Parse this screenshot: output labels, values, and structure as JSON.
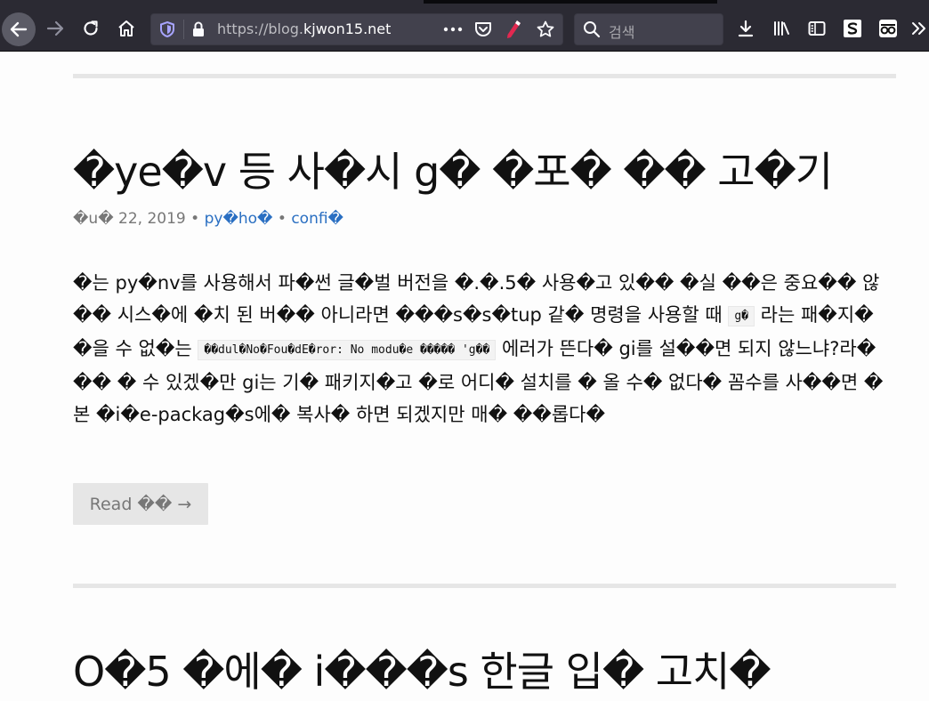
{
  "browser": {
    "url_prefix": "https://blog.",
    "url_host": "kjwon15.net",
    "search_placeholder": "검색",
    "colors": {
      "toolbar_bg": "#2b2a33",
      "urlbar_bg": "#42414d",
      "icon": "#fbfbfe"
    }
  },
  "post": {
    "title": "�ye�v 등 사�시 g� �포� �� 고�기",
    "date": "�u� 22, 2019",
    "separator": "•",
    "tags": [
      "py�ho�",
      "confi�"
    ],
    "body_1": "�는 py�nv를 사용해서 파�썬 글�벌 버전을 �.�.5� 사용�고 있�� �실 ��은 중요�� 않�� 시스�에 �치 된 버�� 아니라면 ���s�s�tup 같� 명령을 사용할 때 ",
    "code_1": "g�",
    "body_2": " 라는 패�지� �을 수 없�는 ",
    "code_2": "��dul�No�Fou�dE�ror: No modu�e ����� 'g��",
    "body_3": " 에러가 뜬다� gi를 설��면 되지 않느냐?라� �� � 수 있겠�만 gi는 기� 패키지�고 �로 어디� 설치를 � 올 수� 없다� 꼼수를 사��면 �본 �i�e-packag�s에� 복사� 하면 되겠지만 매� ��롭다�",
    "read_more": "Read �� →",
    "link_color": "#2a6fc2"
  },
  "next_post": {
    "title": "O�5 �에� i���s 한글 입� 고치�"
  }
}
